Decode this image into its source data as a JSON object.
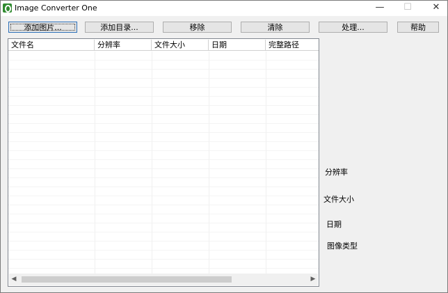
{
  "window": {
    "title": "Image Converter One",
    "icon": "app-icon",
    "controls": {
      "minimize": "—",
      "maximize": "☐",
      "close": "✕"
    }
  },
  "toolbar": {
    "add_image": "添加图片...",
    "add_folder": "添加目录...",
    "remove": "移除",
    "clear": "清除",
    "process": "处理...",
    "help": "帮助"
  },
  "file_list": {
    "columns": [
      "文件名",
      "分辨率",
      "文件大小",
      "日期",
      "完整路径"
    ],
    "rows": []
  },
  "details": {
    "resolution_label": "分辨率",
    "file_size_label": "文件大小",
    "date_label": "日期",
    "image_type_label": "图像类型"
  },
  "colors": {
    "background": "#f0f0f0",
    "list_background": "#ffffff",
    "focus_border": "#2b6fb8",
    "icon_green": "#2f8a2f"
  }
}
